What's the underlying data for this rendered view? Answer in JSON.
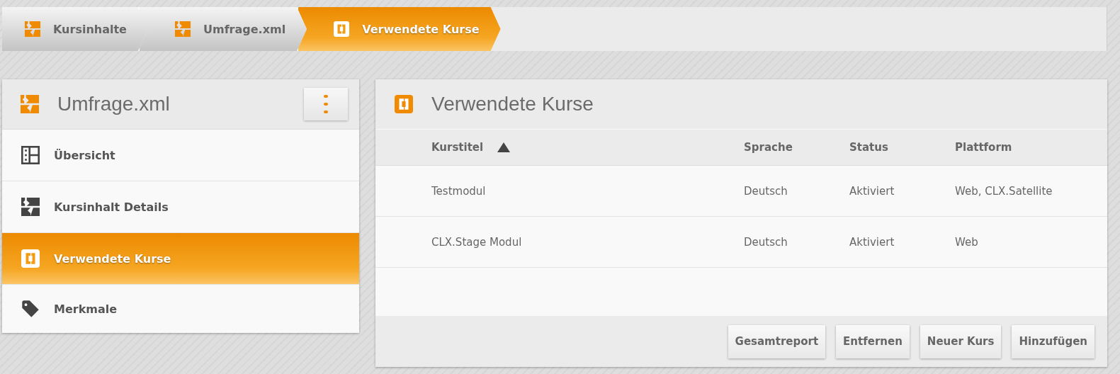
{
  "breadcrumb": [
    {
      "label": "Kursinhalte",
      "kind": "module",
      "selected": false
    },
    {
      "label": "Umfrage.xml",
      "kind": "module",
      "selected": false
    },
    {
      "label": "Verwendete Kurse",
      "kind": "courses",
      "selected": true
    }
  ],
  "sidebar": {
    "title": "Umfrage.xml",
    "items": [
      {
        "label": "Übersicht",
        "kind": "overview",
        "selected": false
      },
      {
        "label": "Kursinhalt Details",
        "kind": "module",
        "selected": false
      },
      {
        "label": "Verwendete Kurse",
        "kind": "courses",
        "selected": true
      },
      {
        "label": "Merkmale",
        "kind": "tag",
        "selected": false
      }
    ]
  },
  "main": {
    "title": "Verwendete Kurse",
    "table": {
      "columns": [
        {
          "label": "Kurstitel",
          "sorted": true
        },
        {
          "label": "Sprache",
          "sorted": false
        },
        {
          "label": "Status",
          "sorted": false
        },
        {
          "label": "Plattform",
          "sorted": false
        }
      ],
      "rows": [
        [
          "Testmodul",
          "Deutsch",
          "Aktiviert",
          "Web, CLX.Satellite"
        ],
        [
          "CLX.Stage Modul",
          "Deutsch",
          "Aktiviert",
          "Web"
        ]
      ]
    },
    "buttons": [
      "Gesamtreport",
      "Entfernen",
      "Neuer Kurs",
      "Hinzufügen"
    ]
  }
}
